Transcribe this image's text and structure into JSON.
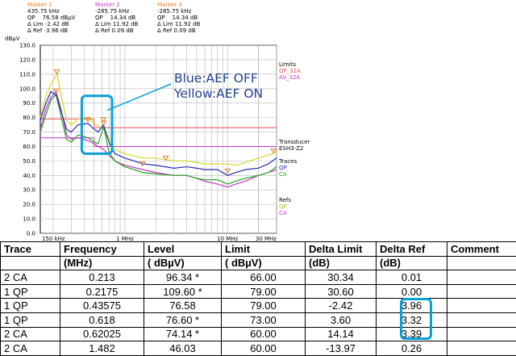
{
  "markers": [
    {
      "title": "Marker 1",
      "lines": [
        "435.75 kHz",
        "QP    76.58 dBµV",
        "Δ Lim -2.42 dB",
        "Δ Ref -3.96 dB"
      ]
    },
    {
      "title": "Marker 2",
      "lines": [
        "-285.75 kHz",
        "QP    14.34 dB",
        "Δ Lim 11.92 dB",
        "Δ Ref 0.09 dB"
      ]
    },
    {
      "title": "Marker 3",
      "lines": [
        "-285.75 kHz",
        "QP    14.34 dB",
        "Δ Lim 11.92 dB",
        "Δ Ref 0.09 dB"
      ]
    }
  ],
  "legend": {
    "limits_label": "Limits",
    "limit_qp": "QP_32A",
    "limit_av": "AV_32A",
    "transducer_label": "Transducer",
    "transducer_name": "ESH3-Z2",
    "traces_label": "Traces",
    "trace_qp": "QP",
    "trace_ca": "CA",
    "refs_label": "Refs",
    "ref_qp": "QP",
    "ref_ca": "CA"
  },
  "annotation": {
    "line1": "Blue:AEF OFF",
    "line2": "Yellow:AEF ON"
  },
  "colors": {
    "trace_qp": "#2a2ab4",
    "trace_ca": "#22a722",
    "ref_qp": "#d6d628",
    "ref_ca": "#cc33cc",
    "limit_qp": "#e0505a",
    "limit_av": "#cc33cc",
    "marker": "#e67e22",
    "highlight": "#0aa0d8",
    "annotation": "#1f3f8f"
  },
  "chart_data": {
    "type": "line",
    "ylabel": "dBµV",
    "x_scale": "log",
    "xlim_mhz": [
      0.15,
      30
    ],
    "ylim": [
      0,
      130
    ],
    "y_ticks": [
      0,
      10,
      20,
      30,
      40,
      50,
      60,
      70,
      80,
      90,
      100,
      110,
      120,
      130
    ],
    "y_tick_labels": [
      "0.0",
      "10.0",
      "20.0",
      "30.0",
      "40.0",
      "50.0",
      "60.0",
      "70.0",
      "80.0",
      "90.0",
      "100.0",
      "110.0",
      "120.0",
      "130.0"
    ],
    "x_tick_labels": [
      {
        "x": 0.15,
        "label": "150 kHz"
      },
      {
        "x": 1,
        "label": "1 MHz"
      },
      {
        "x": 10,
        "label": "10 MHz"
      },
      {
        "x": 30,
        "label": "30 MHz"
      }
    ],
    "grid": true,
    "limits": [
      {
        "name": "QP_32A",
        "segments": [
          {
            "x": [
              0.15,
              0.5
            ],
            "y": [
              79,
              79
            ]
          },
          {
            "x": [
              0.5,
              30
            ],
            "y": [
              73,
              73
            ]
          }
        ]
      },
      {
        "name": "AV_32A",
        "segments": [
          {
            "x": [
              0.15,
              0.5
            ],
            "y": [
              66,
              66
            ]
          },
          {
            "x": [
              0.5,
              30
            ],
            "y": [
              60,
              60
            ]
          }
        ]
      }
    ],
    "series": [
      {
        "name": "QP",
        "x": [
          0.15,
          0.17,
          0.19,
          0.2175,
          0.24,
          0.27,
          0.3,
          0.35,
          0.43575,
          0.5,
          0.55,
          0.618,
          0.7,
          0.8,
          1.0,
          1.5,
          2,
          3,
          4,
          5,
          6,
          8,
          10,
          12,
          15,
          20,
          25,
          30
        ],
        "y": [
          78,
          90,
          98,
          95,
          84,
          72,
          70,
          75,
          76,
          72,
          70,
          75,
          63,
          55,
          52,
          48,
          47,
          45,
          46,
          45,
          44,
          44,
          40,
          42,
          44,
          45,
          48,
          52
        ]
      },
      {
        "name": "CA",
        "x": [
          0.15,
          0.17,
          0.19,
          0.213,
          0.24,
          0.27,
          0.3,
          0.35,
          0.43575,
          0.5,
          0.55,
          0.62025,
          0.7,
          0.8,
          1.0,
          1.5,
          2,
          3,
          4,
          5,
          6,
          8,
          10,
          12,
          15,
          20,
          25,
          30
        ],
        "y": [
          70,
          82,
          92,
          96,
          80,
          65,
          63,
          68,
          66,
          63,
          62,
          74,
          56,
          50,
          46,
          42,
          41,
          40,
          40,
          38,
          37,
          37,
          34,
          36,
          38,
          40,
          42,
          46
        ]
      },
      {
        "name": "Ref QP",
        "x": [
          0.15,
          0.17,
          0.19,
          0.2175,
          0.24,
          0.27,
          0.3,
          0.35,
          0.43575,
          0.5,
          0.55,
          0.618,
          0.7,
          0.8,
          1.0,
          1.5,
          2,
          3,
          4,
          5,
          6,
          8,
          10,
          12,
          15,
          20,
          25,
          30
        ],
        "y": [
          80,
          95,
          103,
          110,
          95,
          78,
          75,
          79,
          80,
          76,
          74,
          72,
          66,
          58,
          55,
          52,
          52,
          50,
          50,
          49,
          48,
          48,
          48,
          47,
          49,
          52,
          54,
          56
        ]
      },
      {
        "name": "Ref CA",
        "x": [
          0.15,
          0.17,
          0.19,
          0.213,
          0.24,
          0.27,
          0.3,
          0.35,
          0.43575,
          0.5,
          0.55,
          0.62025,
          0.7,
          0.8,
          1.0,
          1.5,
          2,
          3,
          4,
          5,
          6,
          8,
          10,
          12,
          15,
          20,
          25,
          30
        ],
        "y": [
          72,
          86,
          94,
          98,
          85,
          68,
          65,
          66,
          64,
          62,
          60,
          58,
          54,
          50,
          47,
          44,
          42,
          40,
          40,
          38,
          36,
          34,
          32,
          34,
          36,
          40,
          42,
          44
        ]
      }
    ],
    "markers": [
      {
        "x": 0.2175,
        "y": 109.6
      },
      {
        "x": 0.43575,
        "y": 76.58
      },
      {
        "x": 0.618,
        "y": 76.6
      },
      {
        "x": 0.62025,
        "y": 74.14
      },
      {
        "x": 0.213,
        "y": 96.34
      },
      {
        "x": 1.482,
        "y": 46.03
      },
      {
        "x": 2.5,
        "y": 50
      },
      {
        "x": 10,
        "y": 41
      },
      {
        "x": 28,
        "y": 55
      }
    ]
  },
  "table": {
    "headers": [
      "Trace",
      "Frequency",
      "Level",
      "Limit",
      "Delta Limit",
      "Delta Ref",
      "Comment"
    ],
    "subheaders": [
      "",
      "(MHz)",
      "( dBµV)",
      "( dBµV)",
      "(dB)",
      "(dB)",
      ""
    ],
    "rows": [
      [
        "2 CA",
        "0.213",
        "96.34 *",
        "66.00",
        "30.34",
        "0.01",
        ""
      ],
      [
        "1 QP",
        "0.2175",
        "109.60 *",
        "79.00",
        "30.60",
        "0.00",
        ""
      ],
      [
        "1 QP",
        "0.43575",
        "76.58",
        "79.00",
        "-2.42",
        "3.96",
        ""
      ],
      [
        "1 QP",
        "0.618",
        "76.60 *",
        "73.00",
        "3.60",
        "3.32",
        ""
      ],
      [
        "2 CA",
        "0.62025",
        "74.14 *",
        "60.00",
        "14.14",
        "3.39",
        ""
      ],
      [
        "2 CA",
        "1.482",
        "46.03",
        "60.00",
        "-13.97",
        "0.26",
        ""
      ]
    ]
  }
}
